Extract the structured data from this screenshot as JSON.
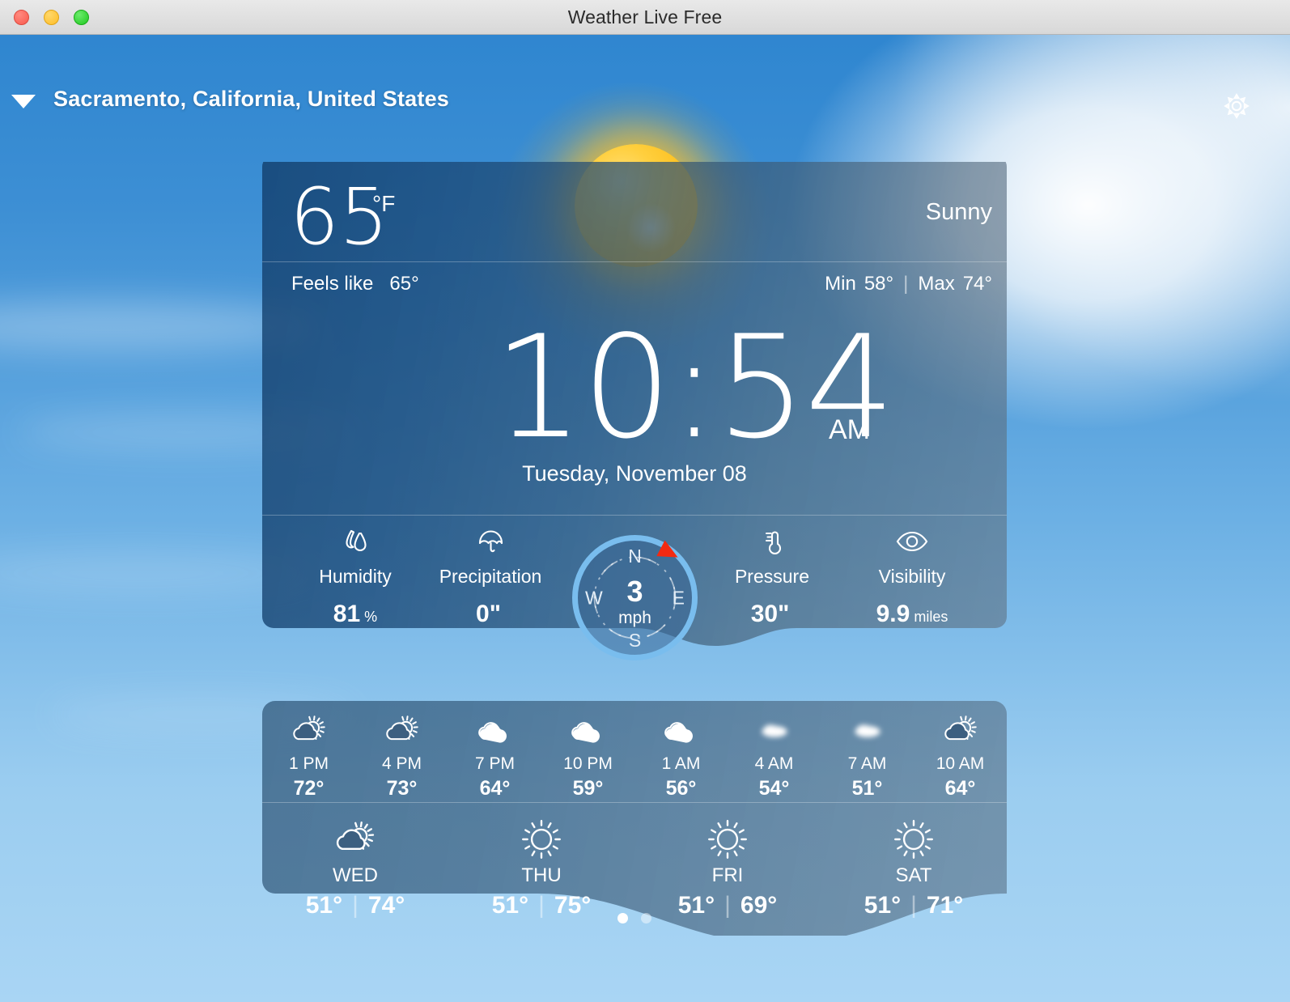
{
  "window": {
    "title": "Weather Live Free",
    "traffic_lights": [
      "close-button",
      "minimize-button",
      "zoom-button"
    ]
  },
  "header": {
    "location": "Sacramento, California, United States",
    "caret_icon": "chevron-down-icon",
    "settings_icon": "gear-icon"
  },
  "current": {
    "temperature": "65",
    "unit": "°F",
    "condition": "Sunny",
    "feels_like_label": "Feels like",
    "feels_like_value": "65°",
    "min_label": "Min",
    "min_value": "58°",
    "max_label": "Max",
    "max_value": "74°",
    "time": "10:54",
    "ampm": "AM",
    "date": "Tuesday, November 08",
    "sky_icon": "sun-icon"
  },
  "metrics": [
    {
      "icon": "humidity-drops-icon",
      "label": "Humidity",
      "value": "81",
      "unit": "%"
    },
    {
      "icon": "umbrella-icon",
      "label": "Precipitation",
      "value": "0\"",
      "unit": ""
    },
    {
      "icon": "thermometer-icon",
      "label": "Pressure",
      "value": "30\"",
      "unit": ""
    },
    {
      "icon": "eye-icon",
      "label": "Visibility",
      "value": "9.9",
      "unit": "miles"
    }
  ],
  "wind": {
    "speed": "3",
    "unit": "mph",
    "directions": {
      "n": "N",
      "e": "E",
      "s": "S",
      "w": "W"
    },
    "needle_icon": "compass-needle-icon",
    "needle_color": "#f42a11",
    "ring_color": "#79bdee"
  },
  "hourly": [
    {
      "time": "1 PM",
      "temp": "72°",
      "icon": "partly-cloudy-icon"
    },
    {
      "time": "4 PM",
      "temp": "73°",
      "icon": "partly-cloudy-icon"
    },
    {
      "time": "7 PM",
      "temp": "64°",
      "icon": "cloudy-icon"
    },
    {
      "time": "10 PM",
      "temp": "59°",
      "icon": "cloudy-icon"
    },
    {
      "time": "1 AM",
      "temp": "56°",
      "icon": "cloudy-icon"
    },
    {
      "time": "4 AM",
      "temp": "54°",
      "icon": "fog-icon"
    },
    {
      "time": "7 AM",
      "temp": "51°",
      "icon": "fog-icon"
    },
    {
      "time": "10 AM",
      "temp": "64°",
      "icon": "partly-cloudy-icon"
    }
  ],
  "daily": [
    {
      "day": "WED",
      "low": "51°",
      "high": "74°",
      "icon": "partly-cloudy-icon"
    },
    {
      "day": "THU",
      "low": "51°",
      "high": "75°",
      "icon": "sunny-icon"
    },
    {
      "day": "FRI",
      "low": "51°",
      "high": "69°",
      "icon": "sunny-icon"
    },
    {
      "day": "SAT",
      "low": "51°",
      "high": "71°",
      "icon": "sunny-icon"
    }
  ],
  "pagination": {
    "total": 2,
    "active": 1
  },
  "colors": {
    "sky_top": "#2f86d0",
    "sky_bottom": "#a9d5f4",
    "card_left": "#2d5f8c",
    "card_right": "#6d8296",
    "accent_ring": "#79bdee",
    "needle": "#f42a11"
  }
}
